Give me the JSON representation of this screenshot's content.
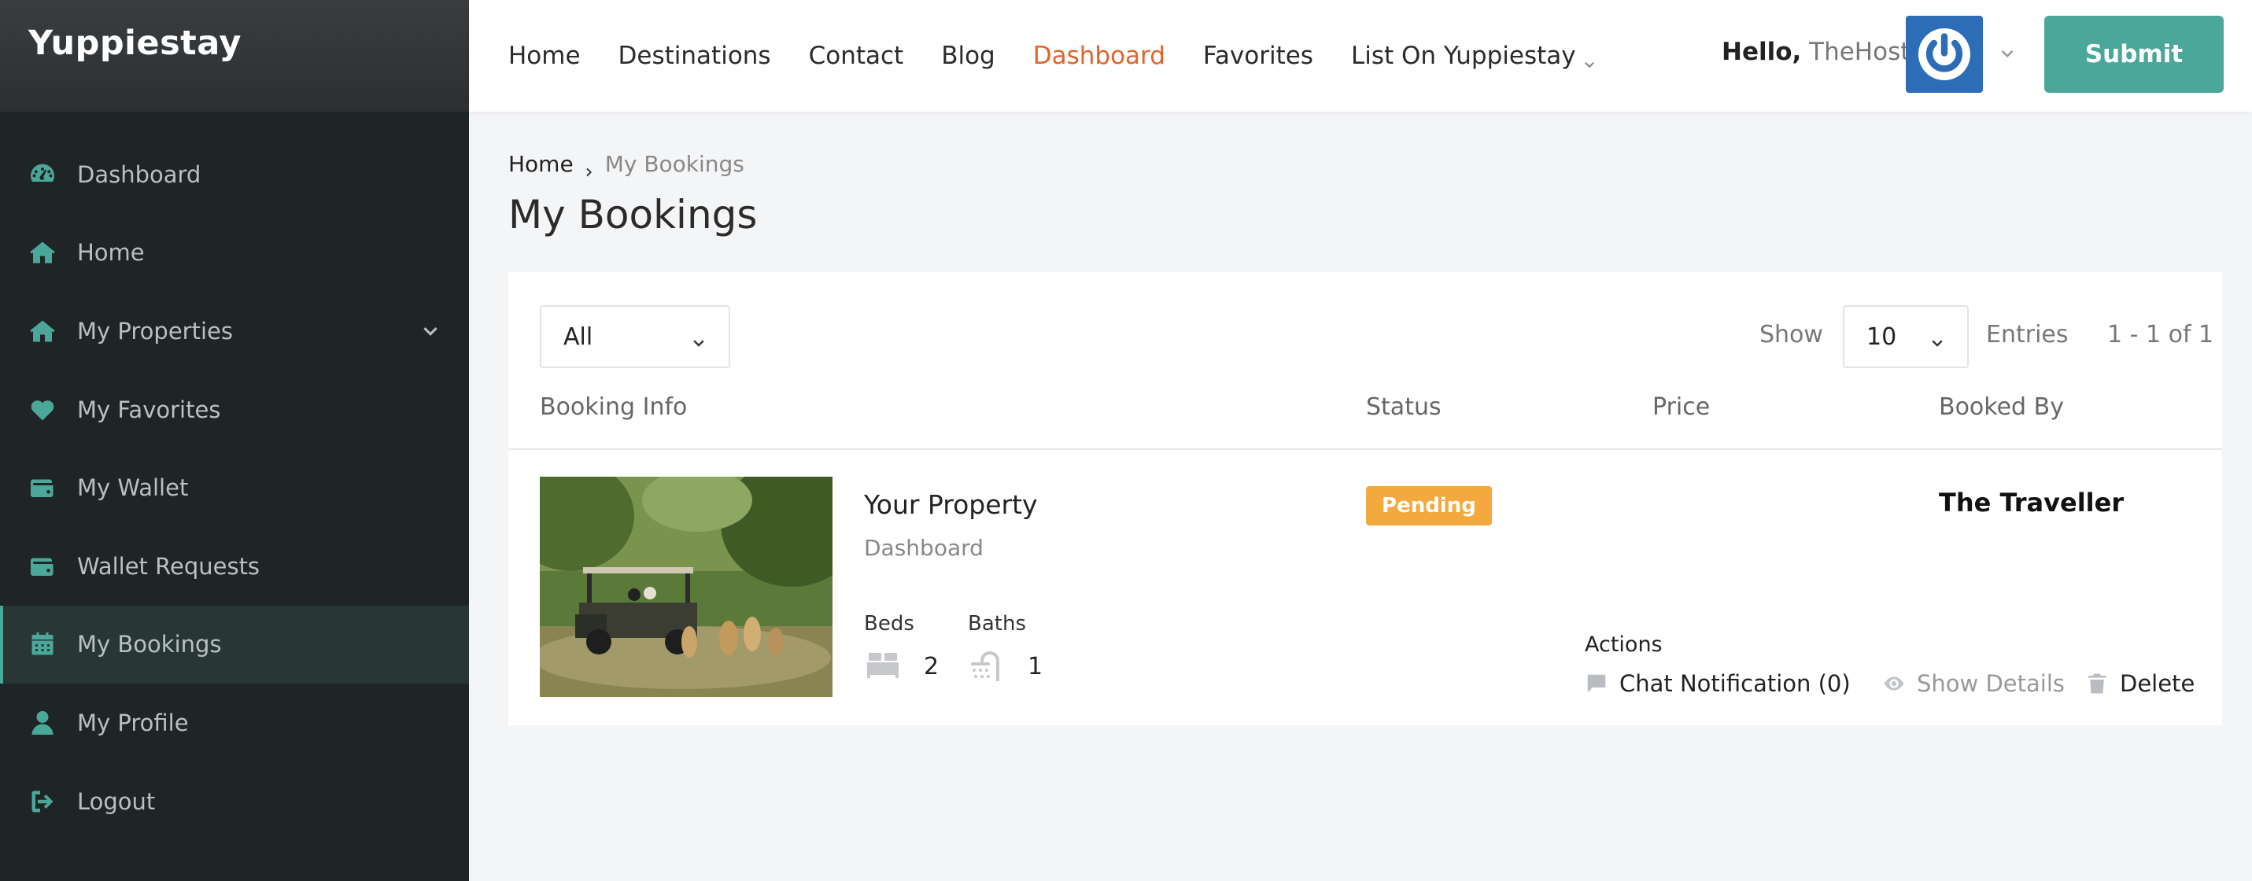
{
  "sidebar": {
    "brand": "Yuppiestay",
    "items": [
      {
        "label": "Dashboard",
        "icon": "gauge-icon"
      },
      {
        "label": "Home",
        "icon": "home-icon"
      },
      {
        "label": "My Properties",
        "icon": "home-icon"
      },
      {
        "label": "My Favorites",
        "icon": "heart-icon"
      },
      {
        "label": "My Wallet",
        "icon": "wallet-icon"
      },
      {
        "label": "Wallet Requests",
        "icon": "wallet-icon"
      },
      {
        "label": "My Bookings",
        "icon": "calendar-icon"
      },
      {
        "label": "My Profile",
        "icon": "user-icon"
      },
      {
        "label": "Logout",
        "icon": "logout-icon"
      }
    ],
    "active": "My Bookings"
  },
  "header": {
    "nav": [
      "Home",
      "Destinations",
      "Contact",
      "Blog",
      "Dashboard",
      "Favorites",
      "List On Yuppiestay"
    ],
    "current": "Dashboard",
    "hello": "Hello,",
    "username": "TheHost",
    "submit_label": "Submit"
  },
  "breadcrumb": {
    "home": "Home",
    "current": "My Bookings"
  },
  "page_title": "My Bookings",
  "table": {
    "filter_value": "All",
    "show_label": "Show",
    "entries_value": "10",
    "entries_label": "Entries",
    "pager": "1 - 1 of 1",
    "columns": [
      "Booking Info",
      "Status",
      "Price",
      "Booked By"
    ],
    "rows": [
      {
        "property": "Your Property",
        "subtitle": "Dashboard",
        "beds_label": "Beds",
        "beds": "2",
        "baths_label": "Baths",
        "baths": "1",
        "status": "Pending",
        "price": "",
        "booked_by": "The Traveller",
        "actions_label": "Actions",
        "actions": [
          "Chat Notification (0)",
          "Show Details",
          "Delete"
        ]
      }
    ]
  },
  "colors": {
    "accent": "#4ca79b",
    "active_nav": "#e0642c",
    "pending": "#f3a93d",
    "sidebar_bg": "#1f2426",
    "avatar_bg": "#2d6db8"
  }
}
